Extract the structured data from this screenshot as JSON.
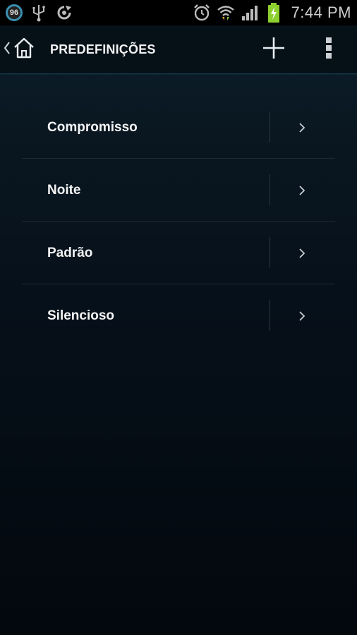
{
  "status_bar": {
    "notification_count": "96",
    "icons_left": [
      "notification-count-badge",
      "usb-icon",
      "sync-app-icon"
    ],
    "icons_right": [
      "alarm-icon",
      "wifi-icon",
      "signal-icon",
      "battery-charging-icon"
    ],
    "time": "7:44 PM"
  },
  "action_bar": {
    "title": "PREDEFINIÇÕES",
    "up_icon": "home-icon",
    "actions": [
      "add-icon",
      "overflow-menu-icon"
    ]
  },
  "presets": [
    {
      "label": "Compromisso"
    },
    {
      "label": "Noite"
    },
    {
      "label": "Padrão"
    },
    {
      "label": "Silencioso"
    }
  ],
  "colors": {
    "accent": "#3b8fb0",
    "battery_green": "#8ccf2e",
    "background_top": "#0e2230",
    "background_bottom": "#03080d"
  }
}
